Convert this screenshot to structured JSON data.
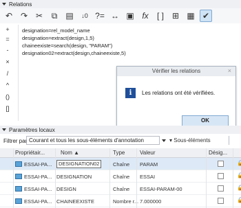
{
  "relations_panel": {
    "title": "Relations",
    "toolbar_icons": [
      "undo-icon",
      "redo-icon",
      "cut-icon",
      "copy-icon",
      "paste-icon",
      "sort-icon",
      "question-icon",
      "width-icon",
      "search-icon",
      "function-icon",
      "brackets-icon",
      "grid-icon",
      "verify-icon",
      "check-icon"
    ],
    "operators": [
      "+",
      "=",
      "-",
      "×",
      "/",
      "^",
      "()",
      "[]"
    ],
    "lines": [
      "designation=rel_model_name",
      "designation=extract(design,1,5)",
      "chaineexiste=search(design, \"PARAM\")",
      "designation02=extract(design,chaineexiste,5)"
    ]
  },
  "dialog": {
    "title": "Vérifier les relations",
    "close": "×",
    "message": "Les relations ont été vérifiées.",
    "ok_label": "OK"
  },
  "params_panel": {
    "title": "Paramètres locaux",
    "filter_label": "Filtrer par",
    "filter_value": "Courant et tous les sous-éléments d'annotation",
    "sub_label": "Sous-éléments",
    "columns": [
      "Propriétair...",
      "Nom ▲",
      "Type",
      "Valeur",
      "Désig..."
    ],
    "rows": [
      {
        "owner": "ESSAI-PA...",
        "name": "DESIGNATION02",
        "type": "Chaîne",
        "value": "PARAM"
      },
      {
        "owner": "ESSAI-PA...",
        "name": "DESIGNATION",
        "type": "Chaîne",
        "value": "ESSAI"
      },
      {
        "owner": "ESSAI-PA...",
        "name": "DESIGN",
        "type": "Chaîne",
        "value": "ESSAI-PARAM-00"
      },
      {
        "owner": "ESSAI-PA...",
        "name": "CHAINEEXISTE",
        "type": "Nombre r...",
        "value": "7.000000"
      }
    ]
  }
}
